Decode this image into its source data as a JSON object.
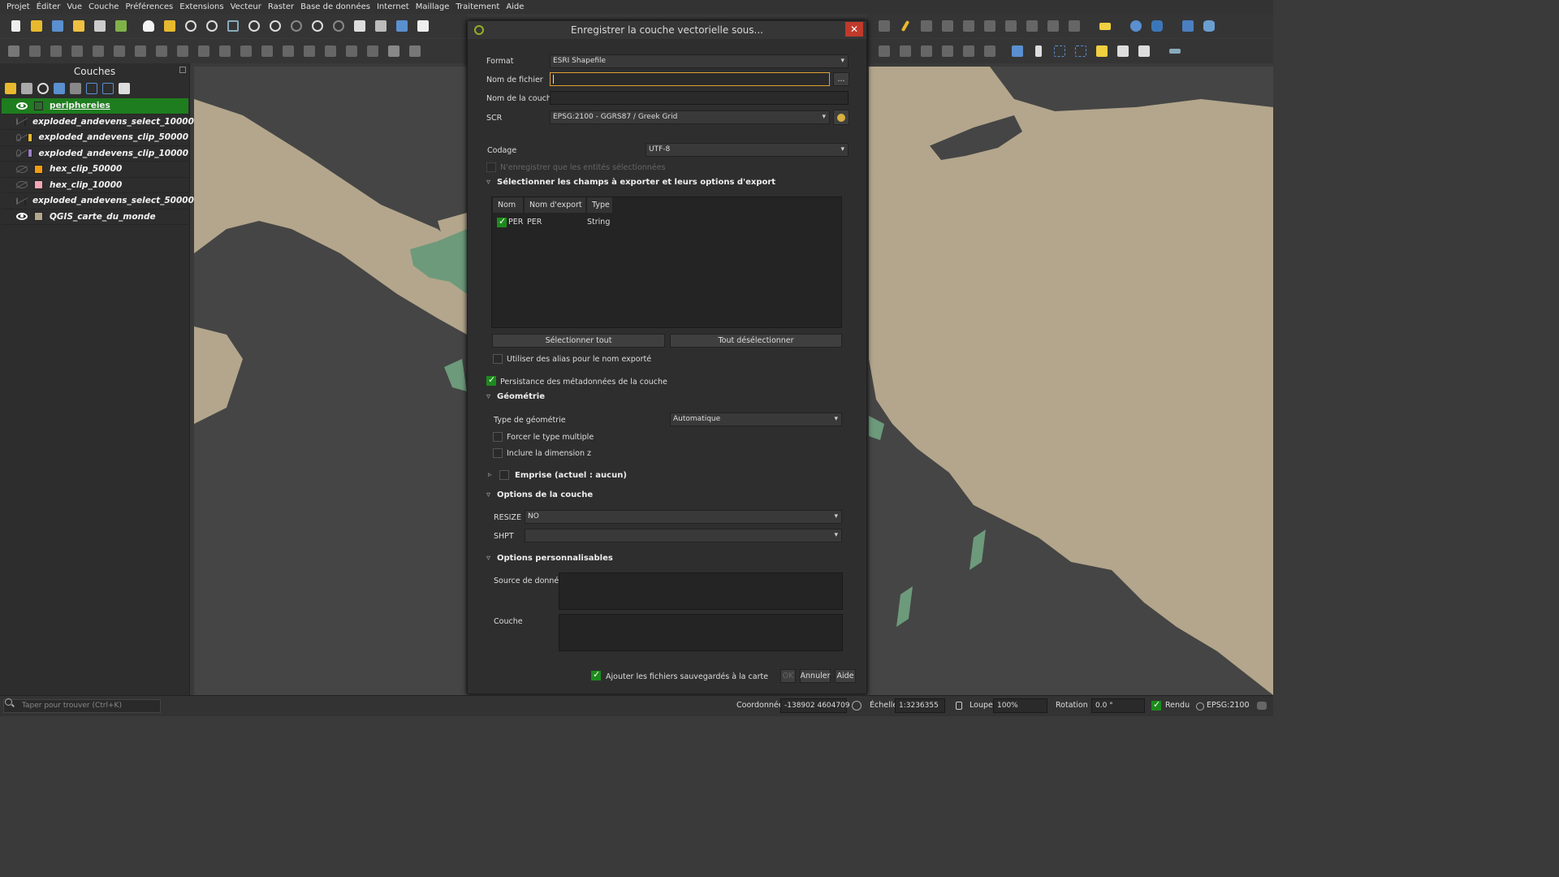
{
  "menubar": {
    "items": [
      "Projet",
      "Éditer",
      "Vue",
      "Couche",
      "Préférences",
      "Extensions",
      "Vecteur",
      "Raster",
      "Base de données",
      "Internet",
      "Maillage",
      "Traitement",
      "Aide"
    ]
  },
  "layers_panel": {
    "title": "Couches",
    "layers": [
      {
        "name": "periphereies",
        "visible": true,
        "color": "#2e6b2e",
        "selected": true
      },
      {
        "name": "exploded_andevens_select_10000",
        "visible": false,
        "color": "#a0522d",
        "selected": false
      },
      {
        "name": "exploded_andevens_clip_50000",
        "visible": false,
        "color": "#e8b92e",
        "selected": false
      },
      {
        "name": "exploded_andevens_clip_10000",
        "visible": false,
        "color": "#9a7fc4",
        "selected": false
      },
      {
        "name": "hex_clip_50000",
        "visible": false,
        "color": "#f39c12",
        "selected": false
      },
      {
        "name": "hex_clip_10000",
        "visible": false,
        "color": "#f4a6b5",
        "selected": false
      },
      {
        "name": "exploded_andevens_select_50000",
        "visible": false,
        "color": "#a0633f",
        "selected": false
      },
      {
        "name": "QGIS_carte_du_monde",
        "visible": true,
        "color": "#b3a68c",
        "selected": false
      }
    ]
  },
  "dialog": {
    "title": "Enregistrer la couche vectorielle sous...",
    "close_glyph": "✕",
    "format_label": "Format",
    "format_value": "ESRI Shapefile",
    "filename_label": "Nom de fichier",
    "filename_value": "",
    "browse_label": "...",
    "layername_label": "Nom de la couche",
    "layername_value": "",
    "crs_label": "SCR",
    "crs_value": "EPSG:2100 - GGRS87 / Greek Grid",
    "encoding_label": "Codage",
    "encoding_value": "UTF-8",
    "only_selected_label": "N'enregistrer que les entités sélectionnées",
    "fields_section": "Sélectionner les champs à exporter et leurs options d'export",
    "fields_table": {
      "headers": [
        "Nom",
        "Nom d'export",
        "Type"
      ],
      "rows": [
        {
          "name": "PER",
          "export": "PER",
          "type": "String",
          "checked": true
        }
      ]
    },
    "select_all": "Sélectionner tout",
    "deselect_all": "Tout désélectionner",
    "use_alias_label": "Utiliser des alias pour le nom exporté",
    "persist_meta_label": "Persistance des métadonnées de la couche",
    "geometry_section": "Géométrie",
    "geom_type_label": "Type de géométrie",
    "geom_type_value": "Automatique",
    "force_multi_label": "Forcer le type multiple",
    "include_z_label": "Inclure la dimension z",
    "extent_section": "Emprise (actuel : aucun)",
    "layer_options_section": "Options de la couche",
    "resize_label": "RESIZE",
    "resize_value": "NO",
    "shpt_label": "SHPT",
    "shpt_value": "",
    "custom_options_section": "Options personnalisables",
    "datasource_label": "Source de donnée",
    "layer_label": "Couche",
    "add_to_map_label": "Ajouter les fichiers sauvegardés à la carte",
    "ok": "OK",
    "cancel": "Annuler",
    "help": "Aide"
  },
  "statusbar": {
    "locator_placeholder": "Taper pour trouver (Ctrl+K)",
    "coord_label": "Coordonnée",
    "coord_value": "-138902  4604709",
    "scale_label": "Échelle",
    "scale_value": "1:3236355",
    "magnifier_label": "Loupe",
    "magnifier_value": "100%",
    "rotation_label": "Rotation",
    "rotation_value": "0.0 °",
    "render_label": "Rendu",
    "crs_value": "EPSG:2100"
  },
  "colors": {
    "accent_green": "#1e7d1e",
    "land": "#b3a68c",
    "sea": "#454545",
    "highlight_land": "#6d9a7b",
    "close_red": "#c0392b"
  }
}
